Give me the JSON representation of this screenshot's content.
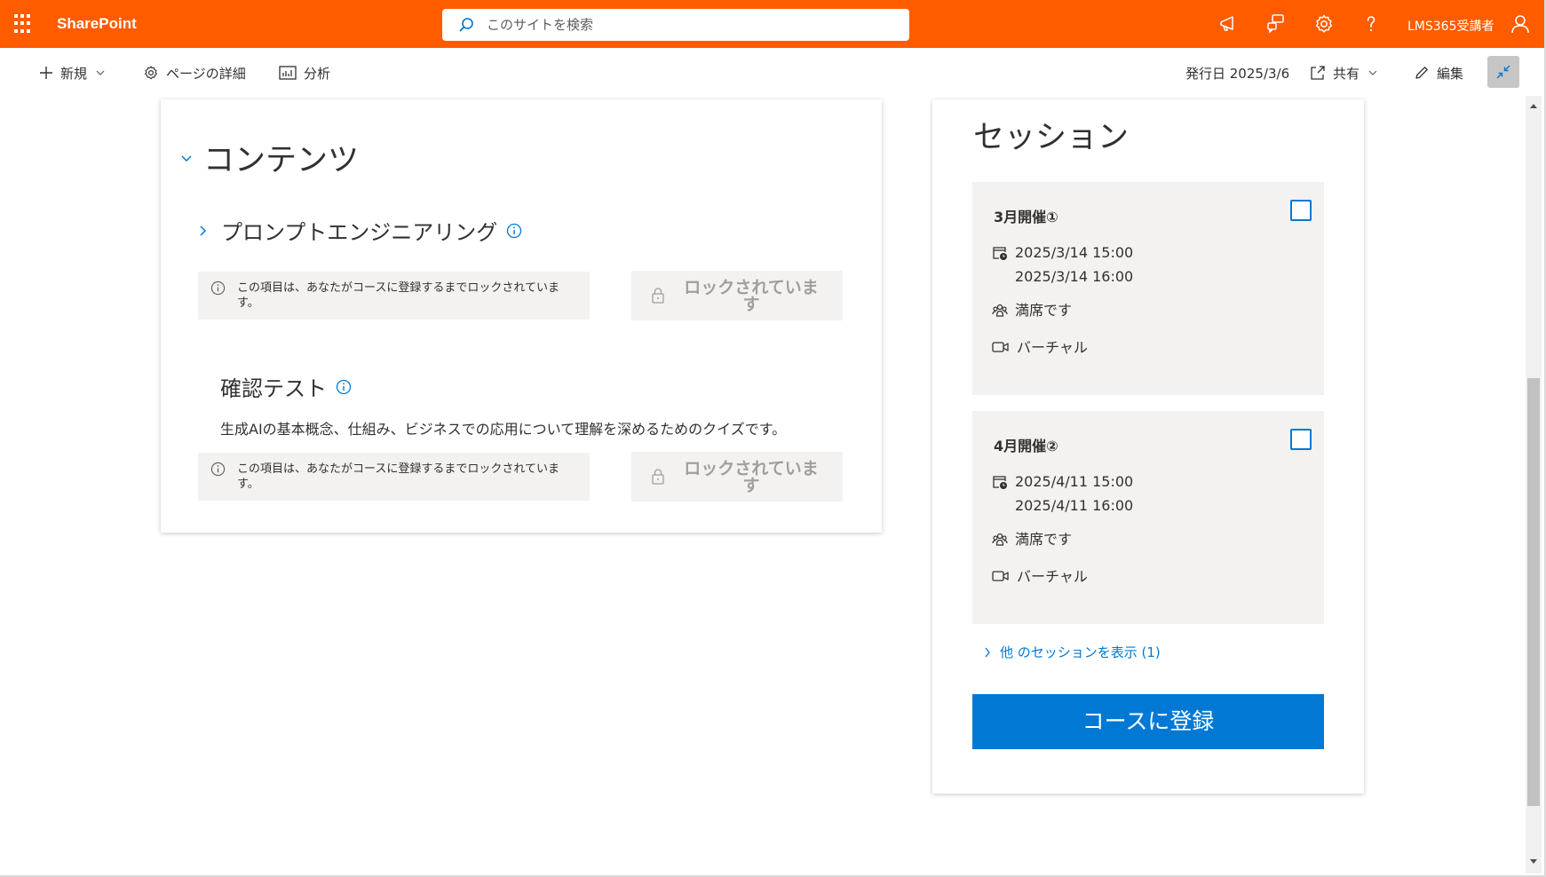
{
  "suitebar": {
    "brand": "SharePoint",
    "search_placeholder": "このサイトを検索",
    "user_name": "LMS365受講者",
    "color": "#ff5c00"
  },
  "commandbar": {
    "new_label": "新規",
    "page_details_label": "ページの詳細",
    "analytics_label": "分析",
    "published_label": "発行日 2025/3/6",
    "share_label": "共有",
    "edit_label": "編集"
  },
  "contents": {
    "title": "コンテンツ",
    "module": {
      "title": "プロンプトエンジニアリング",
      "locked_message": "この項目は、あなたがコースに登録するまでロックされています。",
      "locked_button": "ロックされています"
    },
    "test": {
      "title": "確認テスト",
      "description": "生成AIの基本概念、仕組み、ビジネスでの応用について理解を深めるためのクイズです。",
      "locked_message": "この項目は、あなたがコースに登録するまでロックされています。",
      "locked_button": "ロックされています"
    }
  },
  "sessions": {
    "title": "セッション",
    "items": [
      {
        "name": "3月開催①",
        "start": "2025/3/14 15:00",
        "end": "2025/3/14 16:00",
        "seats": "満席です",
        "location": "バーチャル"
      },
      {
        "name": "4月開催②",
        "start": "2025/4/11 15:00",
        "end": "2025/4/11 16:00",
        "seats": "満席です",
        "location": "バーチャル"
      }
    ],
    "more_link": "他 のセッションを表示 (1)",
    "register_button": "コースに登録",
    "accent": "#0078d4"
  }
}
